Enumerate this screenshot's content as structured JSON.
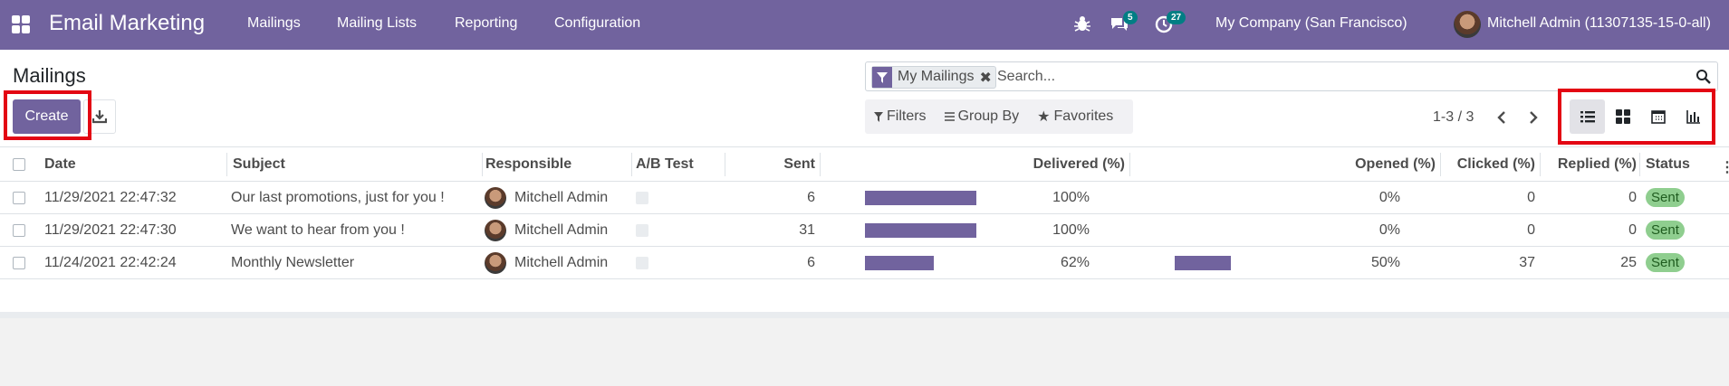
{
  "navbar": {
    "app_title": "Email Marketing",
    "menu": [
      "Mailings",
      "Mailing Lists",
      "Reporting",
      "Configuration"
    ],
    "messages_count": "5",
    "activities_count": "27",
    "company": "My Company (San Francisco)",
    "user": "Mitchell Admin (11307135-15-0-all)"
  },
  "control": {
    "title": "Mailings",
    "create_label": "Create",
    "search": {
      "facet": "My Mailings",
      "placeholder": "Search..."
    },
    "filters_label": "Filters",
    "groupby_label": "Group By",
    "favorites_label": "Favorites",
    "pager": "1-3 / 3"
  },
  "table": {
    "headers": {
      "date": "Date",
      "subject": "Subject",
      "responsible": "Responsible",
      "ab_test": "A/B Test",
      "sent": "Sent",
      "delivered": "Delivered (%)",
      "opened": "Opened (%)",
      "clicked": "Clicked (%)",
      "replied": "Replied (%)",
      "status": "Status"
    },
    "rows": [
      {
        "date": "11/29/2021 22:47:32",
        "subject": "Our last promotions, just for you !",
        "responsible": "Mitchell Admin",
        "sent": "6",
        "delivered": "100%",
        "delivered_fraction": 1.0,
        "opened": "0%",
        "opened_fraction": 0.0,
        "clicked": "0",
        "replied": "0",
        "status": "Sent"
      },
      {
        "date": "11/29/2021 22:47:30",
        "subject": "We want to hear from you !",
        "responsible": "Mitchell Admin",
        "sent": "31",
        "delivered": "100%",
        "delivered_fraction": 1.0,
        "opened": "0%",
        "opened_fraction": 0.0,
        "clicked": "0",
        "replied": "0",
        "status": "Sent"
      },
      {
        "date": "11/24/2021 22:42:24",
        "subject": "Monthly Newsletter",
        "responsible": "Mitchell Admin",
        "sent": "6",
        "delivered": "62%",
        "delivered_fraction": 0.62,
        "opened": "50%",
        "opened_fraction": 0.5,
        "clicked": "37",
        "replied": "25",
        "status": "Sent"
      }
    ]
  },
  "colors": {
    "brand": "#71639e",
    "badge_success": "#8fce8f",
    "highlight": "#e30613"
  },
  "icons": {
    "apps": "apps-grid-icon",
    "bug": "bug-icon",
    "messages": "chat-bubbles-icon",
    "activities": "clock-icon",
    "filter": "funnel-icon",
    "search": "magnifier-icon",
    "download": "download-icon",
    "list_view": "list-view-icon",
    "kanban_view": "kanban-view-icon",
    "calendar_view": "calendar-view-icon",
    "graph_view": "graph-view-icon"
  }
}
